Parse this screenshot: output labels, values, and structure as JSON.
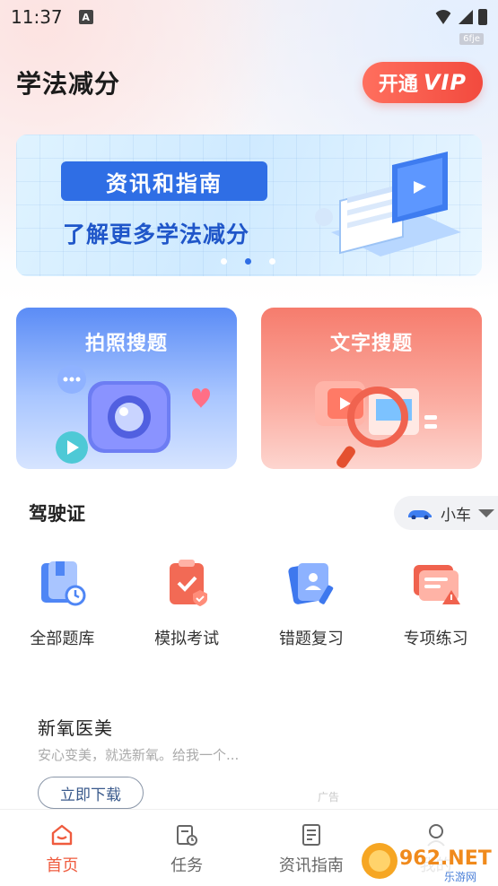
{
  "status_bar": {
    "time": "11:37",
    "notification_letter": "A",
    "tag": "6fje"
  },
  "header": {
    "title": "学法减分",
    "vip_button": {
      "label": "开通",
      "vip_text": "VIP"
    }
  },
  "banner": {
    "title": "资讯和指南",
    "subtitle": "了解更多学法减分",
    "dots": 3,
    "active_dot": 2
  },
  "search_cards": [
    {
      "label": "拍照搜题",
      "icon": "camera-icon"
    },
    {
      "label": "文字搜题",
      "icon": "magnifier-icon"
    }
  ],
  "license_section": {
    "title": "驾驶证",
    "car_type": "小车"
  },
  "features": [
    {
      "label": "全部题库",
      "icon": "question-bank-icon"
    },
    {
      "label": "模拟考试",
      "icon": "mock-exam-icon"
    },
    {
      "label": "错题复习",
      "icon": "mistakes-review-icon"
    },
    {
      "label": "专项练习",
      "icon": "special-practice-icon"
    }
  ],
  "ad": {
    "title": "新氧医美",
    "description": "安心变美，就选新氧。给我一个...",
    "button": "立即下载",
    "tag": "广告"
  },
  "tabs": [
    {
      "label": "首页",
      "icon": "home-icon",
      "active": true
    },
    {
      "label": "任务",
      "icon": "tasks-icon",
      "active": false
    },
    {
      "label": "资讯指南",
      "icon": "news-guide-icon",
      "active": false
    },
    {
      "label": "我的",
      "icon": "profile-icon",
      "active": false
    }
  ],
  "watermark": {
    "brand": "962.NET",
    "sub": "乐游网"
  },
  "colors": {
    "accent": "#ef5b3e",
    "primary_blue": "#2f6ee5"
  }
}
